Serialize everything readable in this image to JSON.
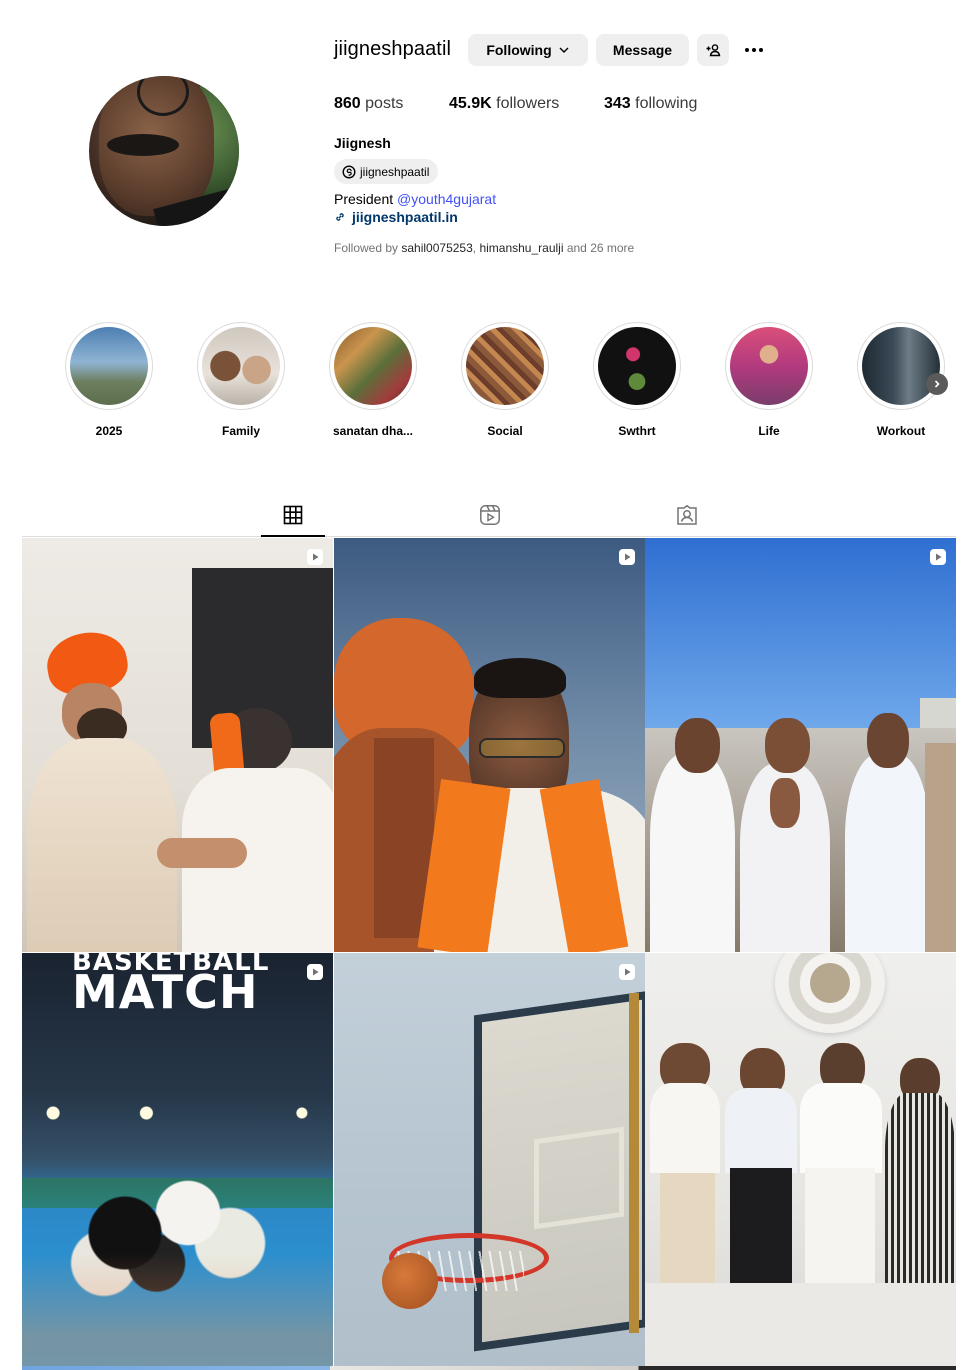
{
  "profile": {
    "username": "jiigneshpaatil",
    "full_name": "Jiignesh",
    "threads_handle": "jiigneshpaatil",
    "bio_prefix": "President ",
    "bio_mention": "@youth4gujarat",
    "link": "jiigneshpaatil.in",
    "followed_by_prefix": "Followed by ",
    "followed_by_user1": "sahil0075253",
    "followed_by_sep": ", ",
    "followed_by_user2": "himanshu_raulji",
    "followed_by_suffix": " and 26 more"
  },
  "actions": {
    "following_label": "Following",
    "message_label": "Message",
    "suggest_icon": "person-add-icon",
    "more_icon": "more-options-icon"
  },
  "stats": {
    "posts_count": "860",
    "posts_label": "posts",
    "followers_count": "45.9K",
    "followers_label": "followers",
    "following_count": "343",
    "following_label": "following"
  },
  "highlights": [
    {
      "label": "2025"
    },
    {
      "label": "Family"
    },
    {
      "label": "sanatan dha..."
    },
    {
      "label": "Social"
    },
    {
      "label": "Swthrt"
    },
    {
      "label": "Life"
    },
    {
      "label": "Workout"
    }
  ],
  "tabs": [
    {
      "icon": "grid-icon",
      "active": true
    },
    {
      "icon": "reels-icon",
      "active": false
    },
    {
      "icon": "tagged-icon",
      "active": false
    }
  ],
  "posts": [
    {
      "type": "reel",
      "overlay_text": ""
    },
    {
      "type": "reel",
      "overlay_text": ""
    },
    {
      "type": "reel",
      "overlay_text": ""
    },
    {
      "type": "reel",
      "overlay_text_top": "BASKETBALL",
      "overlay_text": "MATCH"
    },
    {
      "type": "reel",
      "overlay_text": ""
    },
    {
      "type": "photo",
      "overlay_text": ""
    }
  ],
  "colors": {
    "link_blue": "#4150f7",
    "url_blue": "#00376b",
    "button_bg": "#efefef",
    "muted_text": "#737373"
  }
}
